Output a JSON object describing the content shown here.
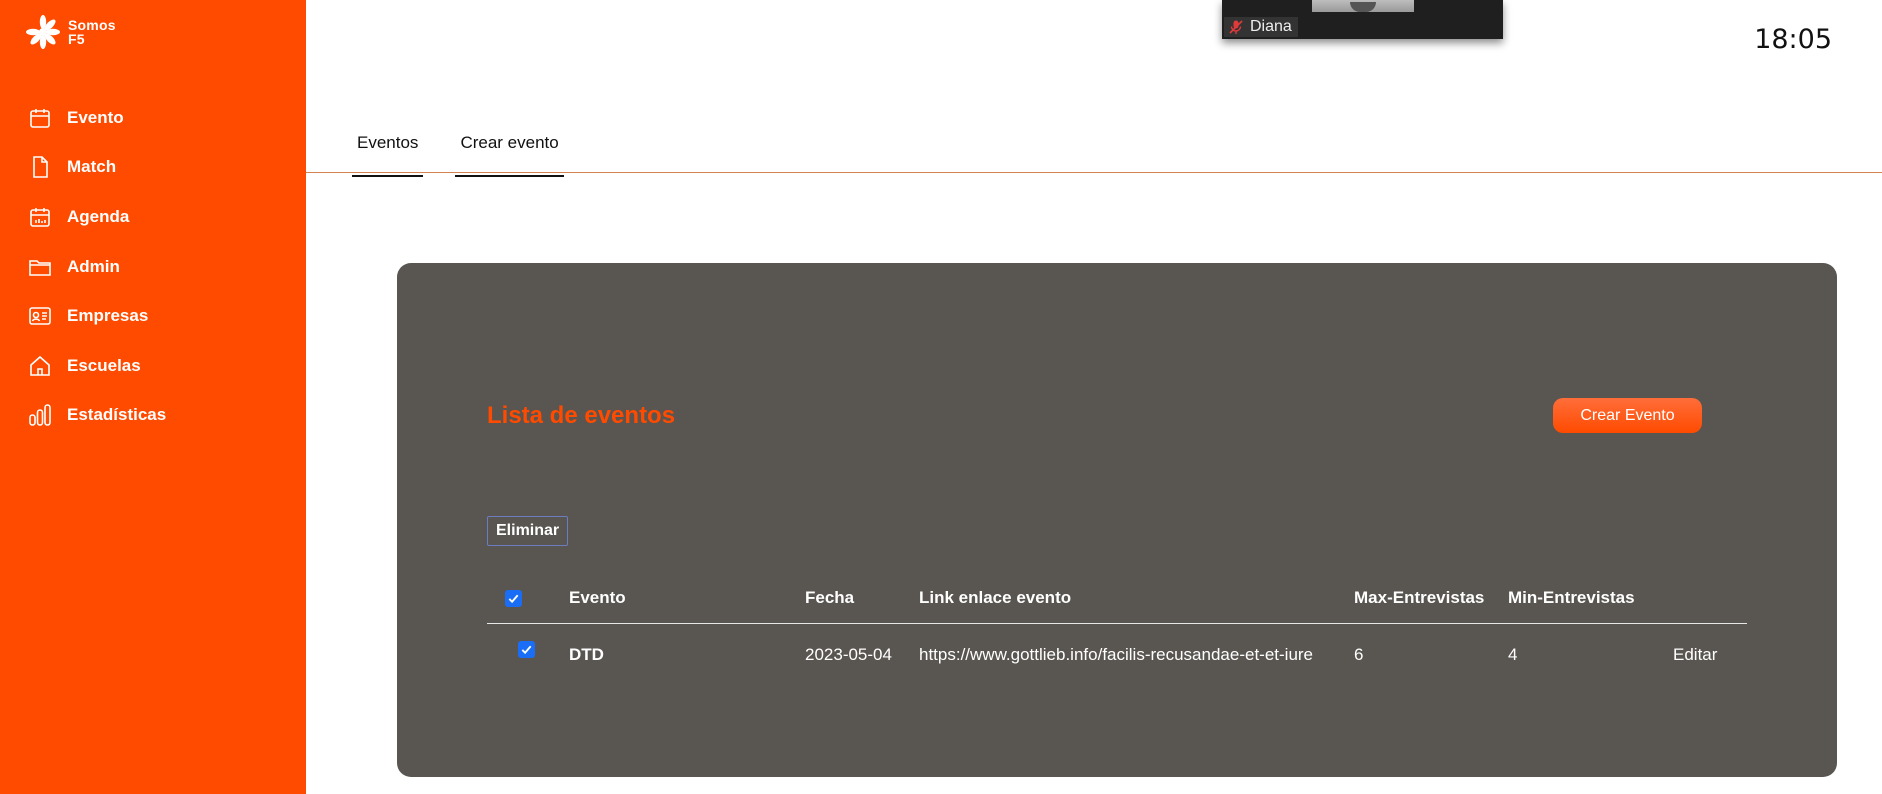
{
  "brand": {
    "name": "Somos\nF5"
  },
  "nav": [
    {
      "label": "Evento",
      "icon": "calendar-icon"
    },
    {
      "label": "Match",
      "icon": "document-icon"
    },
    {
      "label": "Agenda",
      "icon": "agenda-icon"
    },
    {
      "label": "Admin",
      "icon": "folder-icon"
    },
    {
      "label": "Empresas",
      "icon": "id-card-icon"
    },
    {
      "label": "Escuelas",
      "icon": "home-icon"
    },
    {
      "label": "Estadísticas",
      "icon": "bar-chart-icon"
    }
  ],
  "clock": "18:05",
  "video": {
    "participant": "Diana",
    "icon": "mic-muted-icon"
  },
  "tabs": [
    {
      "label": "Eventos"
    },
    {
      "label": "Crear evento"
    }
  ],
  "card": {
    "title": "Lista de eventos",
    "create_button": "Crear Evento",
    "delete_button": "Eliminar",
    "columns": [
      "Evento",
      "Fecha",
      "Link enlace evento",
      "Max-Entrevistas",
      "Min-Entrevistas"
    ],
    "rows": [
      {
        "checked": true,
        "evento": "DTD",
        "fecha": "2023-05-04",
        "link": "https://www.gottlieb.info/facilis-recusandae-et-et-iure",
        "max": "6",
        "min": "4",
        "action": "Editar"
      }
    ]
  },
  "colors": {
    "brand": "#ff4b00",
    "card": "#595550",
    "checkbox": "#1a6ef5"
  }
}
